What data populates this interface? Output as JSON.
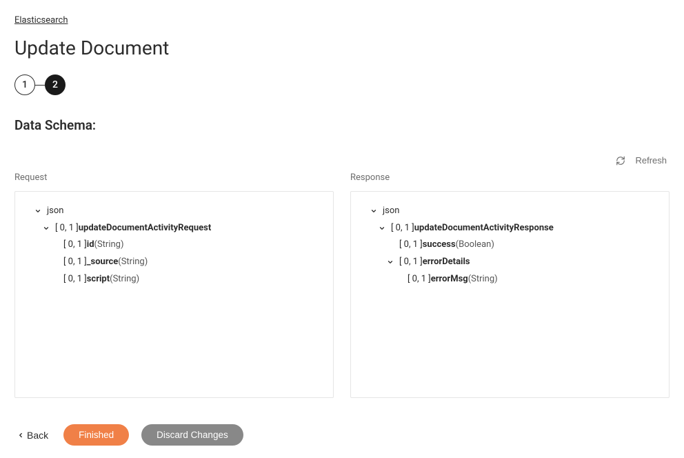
{
  "breadcrumb": {
    "label": "Elasticsearch"
  },
  "title": "Update Document",
  "steps": {
    "items": [
      {
        "label": "1",
        "active": false
      },
      {
        "label": "2",
        "active": true
      }
    ]
  },
  "section_header": "Data Schema:",
  "refresh_label": "Refresh",
  "request": {
    "label": "Request",
    "nodes": [
      {
        "depth": 0,
        "expandable": true,
        "card": null,
        "name": "json",
        "type": null
      },
      {
        "depth": 1,
        "expandable": true,
        "card": "[ 0, 1 ]",
        "name": "updateDocumentActivityRequest",
        "type": null
      },
      {
        "depth": 2,
        "expandable": false,
        "card": "[ 0, 1 ]",
        "name": "id",
        "type": "(String)"
      },
      {
        "depth": 2,
        "expandable": false,
        "card": "[ 0, 1 ]",
        "name": "_source",
        "type": "(String)"
      },
      {
        "depth": 2,
        "expandable": false,
        "card": "[ 0, 1 ]",
        "name": "script",
        "type": "(String)"
      }
    ]
  },
  "response": {
    "label": "Response",
    "nodes": [
      {
        "depth": 0,
        "expandable": true,
        "card": null,
        "name": "json",
        "type": null
      },
      {
        "depth": 1,
        "expandable": true,
        "card": "[ 0, 1 ]",
        "name": "updateDocumentActivityResponse",
        "type": null
      },
      {
        "depth": 2,
        "expandable": false,
        "card": "[ 0, 1 ]",
        "name": "success",
        "type": "(Boolean)"
      },
      {
        "depth": 2,
        "expandable": true,
        "card": "[ 0, 1 ]",
        "name": "errorDetails",
        "type": null
      },
      {
        "depth": 3,
        "expandable": false,
        "card": "[ 0, 1 ]",
        "name": "errorMsg",
        "type": "(String)"
      }
    ]
  },
  "footer": {
    "back": "Back",
    "finished": "Finished",
    "discard": "Discard Changes"
  }
}
